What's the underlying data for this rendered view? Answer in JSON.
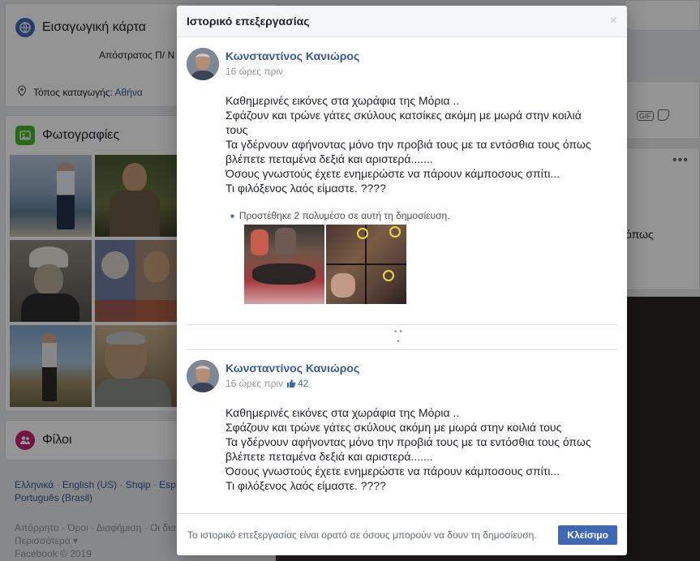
{
  "background": {
    "intro": {
      "title": "Εισαγωγική κάρτα",
      "subtitle": "Απόστρατος Π/ Ν",
      "location_label": "Τόπος καταγωγής:",
      "location_value": "Αθήνα"
    },
    "photos_title": "Φωτογραφίες",
    "friends_title": "Φίλοι",
    "languages": [
      "Ελληνικά",
      "English (US)",
      "Shqip",
      "Esp",
      "Português (Brasil)"
    ],
    "footer_links": "Απόρρητο · Όροι · Διαφήμιση · Οι δια Cookies · Περισσότερα ▾",
    "copyright": "Facebook © 2019",
    "right_snippet": "όπως"
  },
  "modal": {
    "title": "Ιστορικό επεξεργασίας",
    "close_symbol": "×",
    "footer_note": "Το ιστορικό επεξεργασίας είναι ορατό σε όσους μπορούν να δουν τη δημοσίευση.",
    "close_button": "Κλείσιμο",
    "entries": [
      {
        "author": "Κωνσταντίνος Κανιώρος",
        "time": "16 ώρες πριν",
        "lines": [
          "Καθημερινές εικόνες στα χωράφια της Μόρια ..",
          "Σφάζουν και τρώνε γάτες σκύλους κατσίκες ακόμη με μωρά στην κοιλιά",
          "τους",
          "Τα γδέρνουν αφήνοντας μόνο την προβιά τους με τα εντόσθια τους όπως",
          "βλέπετε πεταμένα δεξιά και αριστερά.......",
          "Όσους γνωστούς έχετε ενημερώστε να πάρουν κάμποσους σπίτι...",
          "Τι φιλόξενος λαός είμαστε. ????"
        ],
        "added_media": "Προστέθηκε 2 πολυμέσο σε αυτή τη δημοσίευση."
      },
      {
        "author": "Κωνσταντίνος Κανιώρος",
        "time": "16 ώρες πριν",
        "likes": "42",
        "lines": [
          "Καθημερινές εικόνες στα χωράφια της Μόρια ..",
          "Σφάζουν και τρώνε γάτες σκύλους ακόμη με μωρά στην κοιλιά τους",
          "Τα γδέρνουν αφήνοντας μόνο την προβιά τους με τα εντόσθια τους όπως",
          "βλέπετε πεταμένα δεξιά και αριστερά.......",
          "Όσους γνωστούς έχετε ενημερώστε να πάρουν κάμποσους σπίτι...",
          "Τι φιλόξενος λαός είμαστε. ????"
        ]
      }
    ]
  },
  "colors": {
    "brand_blue": "#4267b2",
    "link_blue": "#365899",
    "meta_gray": "#90949c",
    "overlay": "rgba(0,0,0,0.42)"
  },
  "icons": [
    "globe-icon",
    "location-pin-icon",
    "photo-icon",
    "friends-icon",
    "close-icon",
    "thumbs-up-icon",
    "more-options-icon"
  ]
}
